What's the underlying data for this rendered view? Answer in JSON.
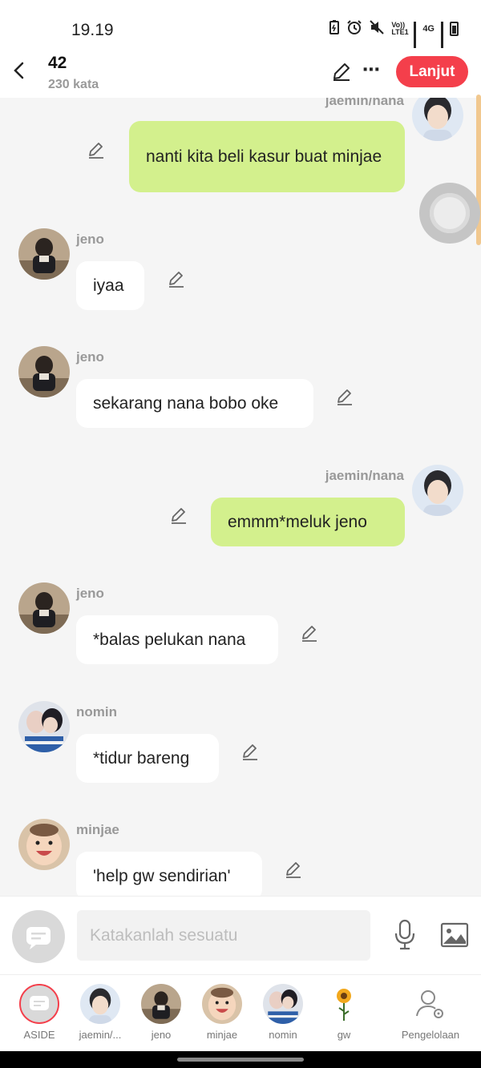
{
  "status_bar": {
    "time": "19.19",
    "network": "4G",
    "volte": "Vo)) LTE1"
  },
  "header": {
    "title": "42",
    "subtitle": "230 kata",
    "next_button": "Lanjut"
  },
  "colors": {
    "accent": "#f43f4b",
    "outgoing_bubble": "#d3f08d",
    "incoming_bubble": "#ffffff",
    "chat_background": "#f5f5f5"
  },
  "messages": [
    {
      "sender": "jaemin/nana",
      "text": "nanti kita beli kasur buat minjae",
      "direction": "out",
      "avatar": "jaemin-avatar"
    },
    {
      "sender": "jeno",
      "text": "iyaa",
      "direction": "in",
      "avatar": "jeno-avatar"
    },
    {
      "sender": "jeno",
      "text": "sekarang nana bobo oke",
      "direction": "in",
      "avatar": "jeno-avatar"
    },
    {
      "sender": "jaemin/nana",
      "text": "emmm*meluk jeno",
      "direction": "out",
      "avatar": "jaemin-avatar"
    },
    {
      "sender": "jeno",
      "text": "*balas pelukan nana",
      "direction": "in",
      "avatar": "jeno-avatar"
    },
    {
      "sender": "nomin",
      "text": "*tidur bareng",
      "direction": "in",
      "avatar": "nomin-avatar"
    },
    {
      "sender": "minjae",
      "text": "'help gw sendirian'",
      "direction": "in",
      "avatar": "minjae-avatar"
    }
  ],
  "composer": {
    "placeholder": "Katakanlah sesuatu"
  },
  "tabs": [
    {
      "label": "ASIDE",
      "icon": "aside-icon"
    },
    {
      "label": "jaemin/...",
      "icon": "jaemin-avatar"
    },
    {
      "label": "jeno",
      "icon": "jeno-avatar"
    },
    {
      "label": "minjae",
      "icon": "minjae-avatar"
    },
    {
      "label": "nomin",
      "icon": "nomin-avatar"
    },
    {
      "label": "gw",
      "icon": "flower-avatar"
    },
    {
      "label": "Pengelolaan",
      "icon": "manage-user-gear-icon"
    }
  ]
}
